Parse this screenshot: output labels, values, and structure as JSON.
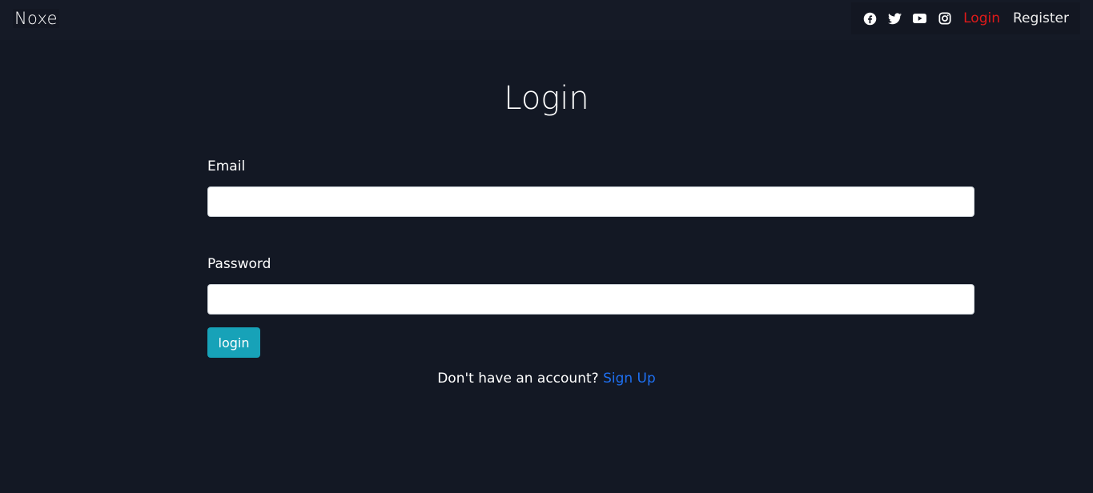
{
  "navbar": {
    "brand": "Noxe",
    "icons": [
      "facebook-icon",
      "twitter-icon",
      "youtube-icon",
      "instagram-icon"
    ],
    "login_label": "Login",
    "register_label": "Register",
    "login_color": "#e01a1a"
  },
  "form": {
    "title": "Login",
    "email_label": "Email",
    "email_value": "",
    "password_label": "Password",
    "password_value": "",
    "submit_label": "login",
    "submit_color": "#17a2b8"
  },
  "footer_prompt": {
    "text": "Don't have an account?",
    "link_label": "Sign Up",
    "link_color": "#1e6ff0"
  },
  "colors": {
    "background": "#131824"
  }
}
